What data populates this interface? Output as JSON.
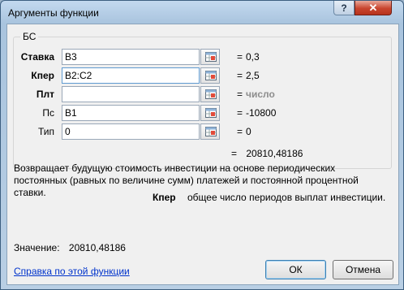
{
  "window": {
    "title": "Аргументы функции",
    "help_icon": "?",
    "close_icon": "✕"
  },
  "function": {
    "name": "БС",
    "args": [
      {
        "label": "Ставка",
        "bold": true,
        "value": "B3",
        "result": "0,3"
      },
      {
        "label": "Кпер",
        "bold": true,
        "value": "B2:C2",
        "result": "2,5"
      },
      {
        "label": "Плт",
        "bold": true,
        "value": "",
        "result": "число"
      },
      {
        "label": "Пс",
        "bold": false,
        "value": "B1",
        "result": "-10800"
      },
      {
        "label": "Тип",
        "bold": false,
        "value": "0",
        "result": "0"
      }
    ],
    "equals_sign": "=",
    "result": "20810,48186",
    "description": "Возвращает будущую стоимость инвестиции на основе периодических постоянных (равных по величине сумм) платежей и постоянной процентной ставки.",
    "arg_desc_name": "Кпер",
    "arg_desc_text": "общее число периодов выплат инвестиции."
  },
  "footer": {
    "value_label": "Значение:",
    "value": "20810,48186",
    "help_link": "Справка по этой функции",
    "ok_label": "ОК",
    "cancel_label": "Отмена"
  },
  "colors": {
    "link": "#0033cc",
    "hint": "#8d8d8d",
    "close": "#c8452e"
  }
}
